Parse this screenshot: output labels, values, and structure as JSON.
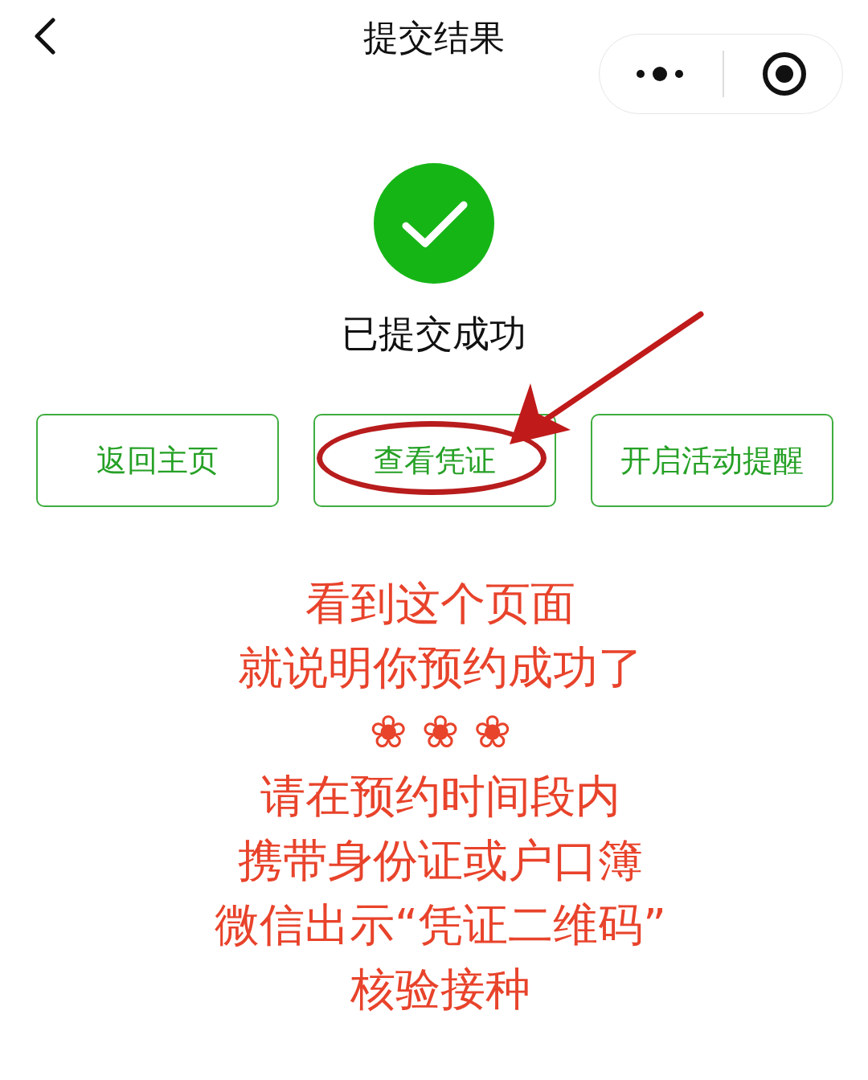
{
  "nav": {
    "title": "提交结果"
  },
  "status": {
    "message": "已提交成功"
  },
  "buttons": [
    {
      "label": "返回主页",
      "highlighted": false
    },
    {
      "label": "查看凭证",
      "highlighted": true
    },
    {
      "label": "开启活动提醒",
      "highlighted": false
    }
  ],
  "notes": [
    "看到这个页面",
    "就说明你预约成功了",
    "❀ ❀ ❀",
    "请在预约时间段内",
    "携带身份证或户口簿",
    "微信出示“凭证二维码”",
    "核验接种"
  ]
}
